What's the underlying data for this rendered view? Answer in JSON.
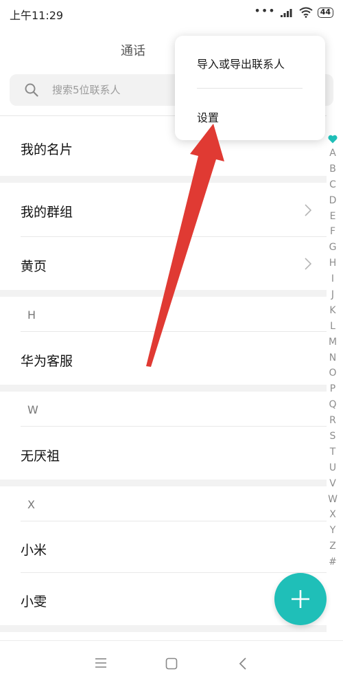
{
  "status_bar": {
    "time": "上午11:29",
    "dots": "•••",
    "battery": "44"
  },
  "header": {
    "tab": "通话"
  },
  "search": {
    "placeholder": "搜索5位联系人"
  },
  "rows": {
    "my_card": "我的名片",
    "my_groups": "我的群组",
    "yellow_pages": "黄页"
  },
  "sections": [
    {
      "letter": "H",
      "contacts": [
        "华为客服"
      ]
    },
    {
      "letter": "W",
      "contacts": [
        "无厌祖"
      ]
    },
    {
      "letter": "X",
      "contacts": [
        "小米",
        "小雯"
      ]
    }
  ],
  "index_rail": [
    "A",
    "B",
    "C",
    "D",
    "E",
    "F",
    "G",
    "H",
    "I",
    "J",
    "K",
    "L",
    "M",
    "N",
    "O",
    "P",
    "Q",
    "R",
    "S",
    "T",
    "U",
    "V",
    "W",
    "X",
    "Y",
    "Z",
    "#"
  ],
  "popup_menu": {
    "items": [
      "导入或导出联系人",
      "设置"
    ]
  },
  "icons": {
    "search": "search-icon",
    "chevron": "chevron-right-icon",
    "favorite": "heart-icon",
    "add": "plus-icon",
    "menu": "menu-icon",
    "home": "home-icon",
    "back": "back-icon"
  },
  "colors": {
    "accent": "#1fbfb8",
    "arrow": "#e03a33"
  }
}
